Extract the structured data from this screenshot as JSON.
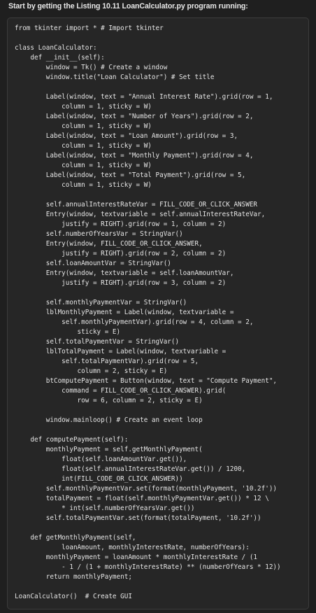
{
  "heading": "Start by getting the Listing 10.11 LoanCalculator.py program running:",
  "code": [
    "from tkinter import * # Import tkinter",
    "",
    "class LoanCalculator:",
    "    def __init__(self):",
    "        window = Tk() # Create a window",
    "        window.title(\"Loan Calculator\") # Set title",
    "",
    "        Label(window, text = \"Annual Interest Rate\").grid(row = 1,",
    "            column = 1, sticky = W)",
    "        Label(window, text = \"Number of Years\").grid(row = 2,",
    "            column = 1, sticky = W)",
    "        Label(window, text = \"Loan Amount\").grid(row = 3,",
    "            column = 1, sticky = W)",
    "        Label(window, text = \"Monthly Payment\").grid(row = 4,",
    "            column = 1, sticky = W)",
    "        Label(window, text = \"Total Payment\").grid(row = 5,",
    "            column = 1, sticky = W)",
    "",
    "        self.annualInterestRateVar = FILL_CODE_OR_CLICK_ANSWER",
    "        Entry(window, textvariable = self.annualInterestRateVar,",
    "            justify = RIGHT).grid(row = 1, column = 2)",
    "        self.numberOfYearsVar = StringVar()",
    "        Entry(window, FILL_CODE_OR_CLICK_ANSWER,",
    "            justify = RIGHT).grid(row = 2, column = 2)",
    "        self.loanAmountVar = StringVar()",
    "        Entry(window, textvariable = self.loanAmountVar,",
    "            justify = RIGHT).grid(row = 3, column = 2)",
    "",
    "        self.monthlyPaymentVar = StringVar()",
    "        lblMonthlyPayment = Label(window, textvariable =",
    "            self.monthlyPaymentVar).grid(row = 4, column = 2,",
    "                sticky = E)",
    "        self.totalPaymentVar = StringVar()",
    "        lblTotalPayment = Label(window, textvariable =",
    "            self.totalPaymentVar).grid(row = 5,",
    "                column = 2, sticky = E)",
    "        btComputePayment = Button(window, text = \"Compute Payment\",",
    "            command = FILL_CODE_OR_CLICK_ANSWER).grid(",
    "                row = 6, column = 2, sticky = E)",
    "",
    "        window.mainloop() # Create an event loop",
    "",
    "    def computePayment(self):",
    "        monthlyPayment = self.getMonthlyPayment(",
    "            float(self.loanAmountVar.get()),",
    "            float(self.annualInterestRateVar.get()) / 1200,",
    "            int(FILL_CODE_OR_CLICK_ANSWER))",
    "        self.monthlyPaymentVar.set(format(monthlyPayment, '10.2f'))",
    "        totalPayment = float(self.monthlyPaymentVar.get()) * 12 \\",
    "            * int(self.numberOfYearsVar.get())",
    "        self.totalPaymentVar.set(format(totalPayment, '10.2f'))",
    "",
    "    def getMonthlyPayment(self,",
    "            loanAmount, monthlyInterestRate, numberOfYears):",
    "        monthlyPayment = loanAmount * monthlyInterestRate / (1",
    "            - 1 / (1 + monthlyInterestRate) ** (numberOfYears * 12))",
    "        return monthlyPayment;",
    "",
    "LoanCalculator()  # Create GUI"
  ]
}
